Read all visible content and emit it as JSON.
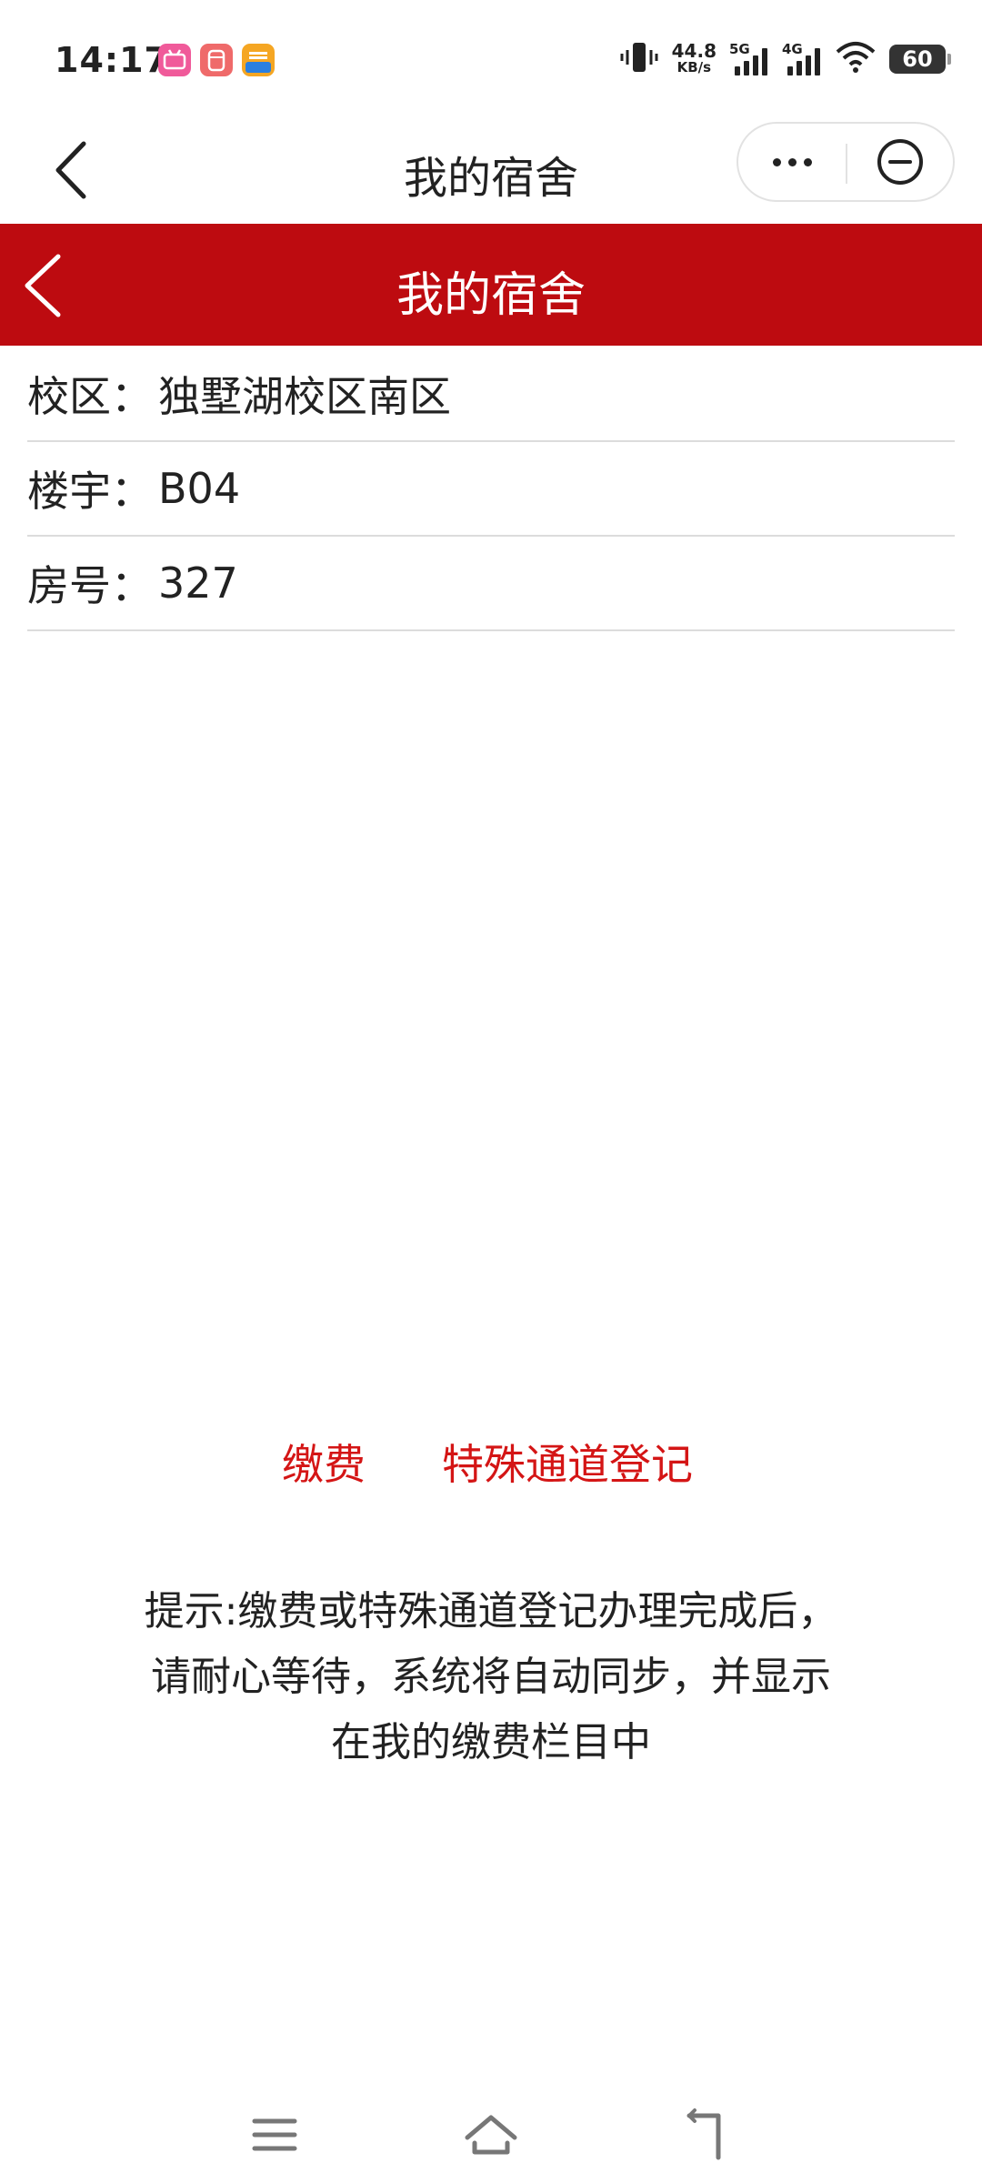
{
  "status_bar": {
    "time": "14:17",
    "net_speed_value": "44.8",
    "net_speed_unit": "KB/s",
    "sim1_label": "5G",
    "sim2_label": "4G",
    "battery": "60",
    "app_badges": [
      {
        "icon": "bilibili-icon",
        "color": "#f05a9a"
      },
      {
        "icon": "app-cylinder-icon",
        "color": "#ef6a6a"
      },
      {
        "icon": "taobao-xianyu-icon",
        "color": "#f5a623"
      }
    ]
  },
  "mp_nav": {
    "title": "我的宿舍",
    "back_icon": "chevron-left-icon",
    "more_icon": "more-dots-icon",
    "close_icon": "minus-circle-icon"
  },
  "header": {
    "title": "我的宿舍",
    "background": "#bd0b10",
    "back_icon": "chevron-left-icon"
  },
  "info": [
    {
      "label": "校区：",
      "value": "独墅湖校区南区"
    },
    {
      "label": "楼宇：",
      "value": "B04"
    },
    {
      "label": "房号：",
      "value": "327"
    }
  ],
  "actions": {
    "pay": "缴费",
    "special_channel": "特殊通道登记",
    "color": "#d41515"
  },
  "tip": {
    "line1": "提示:缴费或特殊通道登记办理完成后，",
    "line2": "请耐心等待，系统将自动同步，并显示",
    "line3": "在我的缴费栏目中"
  },
  "bottom_nav": {
    "menu_icon": "menu-icon",
    "home_icon": "home-icon",
    "back_icon": "back-icon"
  }
}
